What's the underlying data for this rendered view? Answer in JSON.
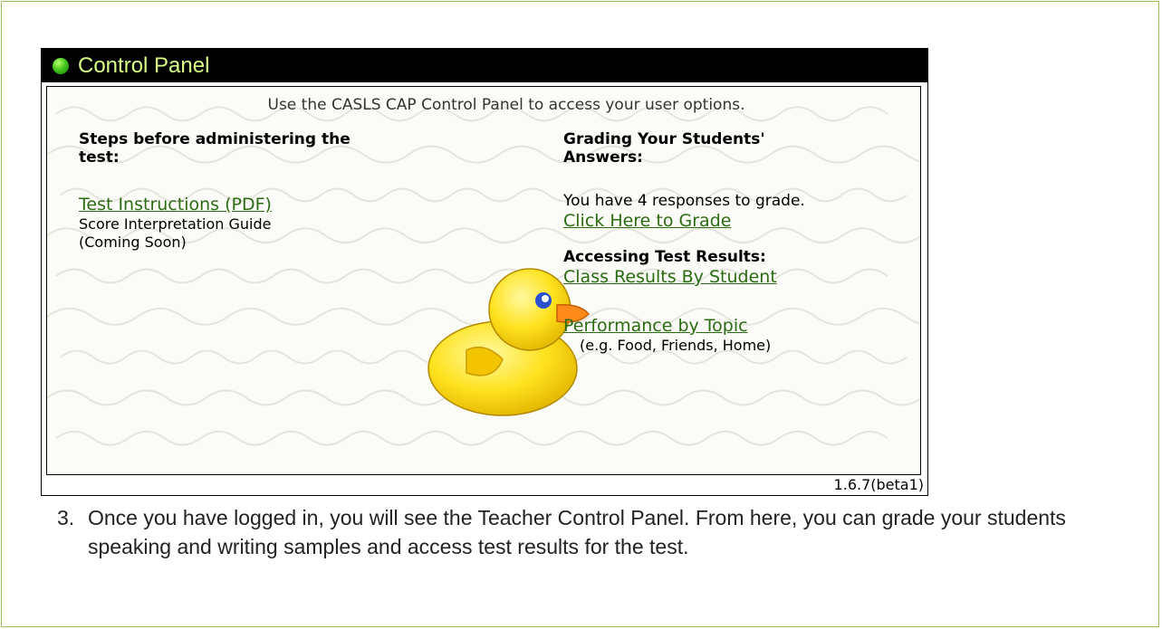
{
  "panel": {
    "title": "Control Panel",
    "intro": "Use the CASLS CAP Control Panel to access your user options.",
    "left": {
      "heading": "Steps before administering the test:",
      "test_instructions_link": "Test Instructions (PDF)",
      "score_guide_line1": "Score Interpretation Guide",
      "score_guide_line2": "(Coming Soon)"
    },
    "right": {
      "grading_heading": "Grading Your Students' Answers:",
      "responses_text": "You have 4 responses to grade.",
      "grade_link": "Click Here to Grade",
      "results_heading": "Accessing Test Results:",
      "class_results_link": "Class Results By Student",
      "performance_link": "Performance by Topic",
      "performance_example": "(e.g. Food, Friends, Home)"
    },
    "version": "1.6.7(beta1)"
  },
  "step": {
    "number": "3.",
    "text": "Once you have logged in, you will see the Teacher Control Panel. From here, you can grade your students speaking and writing samples and access test results for the test."
  },
  "colors": {
    "header_bg": "#000000",
    "header_text": "#d8ff86",
    "link": "#2b6b12",
    "frame": "#9bbb59"
  }
}
